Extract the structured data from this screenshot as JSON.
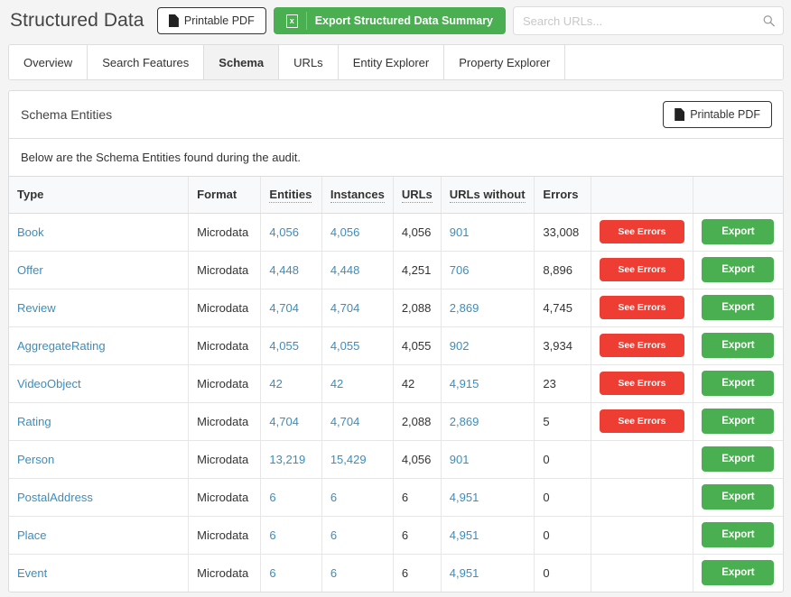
{
  "header": {
    "title": "Structured Data",
    "printable_pdf_label": "Printable PDF",
    "export_summary_label": "Export Structured Data Summary",
    "search_placeholder": "Search URLs...",
    "search_value": "",
    "accent_green": "#4aaf50",
    "accent_red": "#ee3d33",
    "link_blue": "#3c8dbc"
  },
  "tabs": [
    {
      "label": "Overview",
      "active": false
    },
    {
      "label": "Search Features",
      "active": false
    },
    {
      "label": "Schema",
      "active": true
    },
    {
      "label": "URLs",
      "active": false
    },
    {
      "label": "Entity Explorer",
      "active": false
    },
    {
      "label": "Property Explorer",
      "active": false
    }
  ],
  "panel": {
    "title": "Schema Entities",
    "printable_pdf_label": "Printable PDF",
    "description": "Below are the Schema Entities found during the audit."
  },
  "table": {
    "columns": [
      {
        "label": "Type",
        "dotted": false
      },
      {
        "label": "Format",
        "dotted": false
      },
      {
        "label": "Entities",
        "dotted": true
      },
      {
        "label": "Instances",
        "dotted": true
      },
      {
        "label": "URLs",
        "dotted": true
      },
      {
        "label": "URLs without",
        "dotted": true
      },
      {
        "label": "Errors",
        "dotted": false
      },
      {
        "label": "",
        "dotted": false
      },
      {
        "label": "",
        "dotted": false
      }
    ],
    "see_errors_label": "See Errors",
    "export_label": "Export",
    "rows": [
      {
        "type": "Book",
        "format": "Microdata",
        "entities": "4,056",
        "instances": "4,056",
        "urls": "4,056",
        "urls_without": "901",
        "errors": "33,008",
        "has_errors_button": true,
        "has_export_button": true
      },
      {
        "type": "Offer",
        "format": "Microdata",
        "entities": "4,448",
        "instances": "4,448",
        "urls": "4,251",
        "urls_without": "706",
        "errors": "8,896",
        "has_errors_button": true,
        "has_export_button": true
      },
      {
        "type": "Review",
        "format": "Microdata",
        "entities": "4,704",
        "instances": "4,704",
        "urls": "2,088",
        "urls_without": "2,869",
        "errors": "4,745",
        "has_errors_button": true,
        "has_export_button": true
      },
      {
        "type": "AggregateRating",
        "format": "Microdata",
        "entities": "4,055",
        "instances": "4,055",
        "urls": "4,055",
        "urls_without": "902",
        "errors": "3,934",
        "has_errors_button": true,
        "has_export_button": true
      },
      {
        "type": "VideoObject",
        "format": "Microdata",
        "entities": "42",
        "instances": "42",
        "urls": "42",
        "urls_without": "4,915",
        "errors": "23",
        "has_errors_button": true,
        "has_export_button": true
      },
      {
        "type": "Rating",
        "format": "Microdata",
        "entities": "4,704",
        "instances": "4,704",
        "urls": "2,088",
        "urls_without": "2,869",
        "errors": "5",
        "has_errors_button": true,
        "has_export_button": true
      },
      {
        "type": "Person",
        "format": "Microdata",
        "entities": "13,219",
        "instances": "15,429",
        "urls": "4,056",
        "urls_without": "901",
        "errors": "0",
        "has_errors_button": false,
        "has_export_button": true
      },
      {
        "type": "PostalAddress",
        "format": "Microdata",
        "entities": "6",
        "instances": "6",
        "urls": "6",
        "urls_without": "4,951",
        "errors": "0",
        "has_errors_button": false,
        "has_export_button": true
      },
      {
        "type": "Place",
        "format": "Microdata",
        "entities": "6",
        "instances": "6",
        "urls": "6",
        "urls_without": "4,951",
        "errors": "0",
        "has_errors_button": false,
        "has_export_button": true
      },
      {
        "type": "Event",
        "format": "Microdata",
        "entities": "6",
        "instances": "6",
        "urls": "6",
        "urls_without": "4,951",
        "errors": "0",
        "has_errors_button": false,
        "has_export_button": true
      }
    ]
  }
}
